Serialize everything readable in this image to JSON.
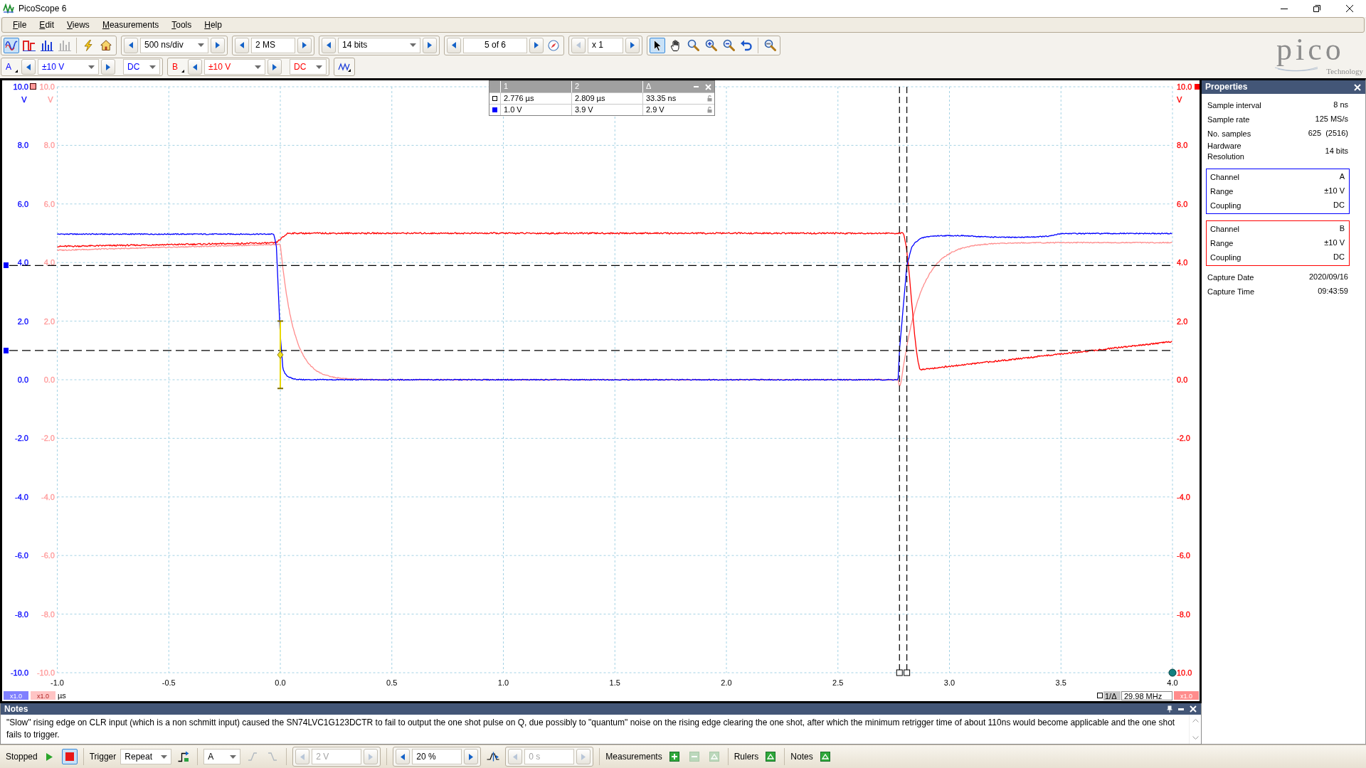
{
  "window": {
    "title": "PicoScope 6",
    "controls": [
      {
        "kind": "minimize"
      },
      {
        "kind": "restore"
      },
      {
        "kind": "close"
      }
    ]
  },
  "menu": [
    {
      "label": "File"
    },
    {
      "label": "Edit"
    },
    {
      "label": "Views"
    },
    {
      "label": "Measurements"
    },
    {
      "label": "Tools"
    },
    {
      "label": "Help"
    }
  ],
  "toolbar": {
    "view_modes": [
      {
        "kind": "scope",
        "selected": true,
        "disabled": false
      },
      {
        "kind": "persistence",
        "selected": false,
        "disabled": false
      },
      {
        "kind": "spectrum",
        "selected": false,
        "disabled": false
      },
      {
        "kind": "spectrum",
        "selected": false,
        "disabled": true
      }
    ],
    "setup_buttons": [
      {
        "kind": "auto_setup"
      },
      {
        "kind": "default_setup"
      }
    ],
    "timebase": "500 ns/div",
    "samples": "2 MS",
    "resolution": "14 bits",
    "buffer": "5 of 6",
    "zoom": {
      "value": "x 1",
      "decrease_disabled": true
    },
    "tools": [
      {
        "kind": "pointer",
        "selected": true
      },
      {
        "kind": "hand",
        "selected": false
      },
      {
        "kind": "zoom_region",
        "selected": false
      },
      {
        "kind": "zoom_in",
        "selected": false
      },
      {
        "kind": "zoom_out",
        "selected": false
      },
      {
        "kind": "undo",
        "selected": false
      },
      {
        "kind": "zoom_fit",
        "selected": false
      }
    ]
  },
  "logo": {
    "wordmark": "pico",
    "tagline": "Technology"
  },
  "channels": [
    {
      "label": "A",
      "color": "#0000ff",
      "range": "±10 V",
      "coupling": "DC"
    },
    {
      "label": "B",
      "color": "#ff0000",
      "range": "±10 V",
      "coupling": "DC"
    }
  ],
  "scope": {
    "left_axes": [
      {
        "color": "#0000ff",
        "unit": "V",
        "labels": [
          "10.0",
          "8.0",
          "6.0",
          "4.0",
          "2.0",
          "0.0",
          "-2.0",
          "-4.0",
          "-6.0",
          "-8.0",
          "-10.0"
        ]
      },
      {
        "color": "#ff9999",
        "unit": "V",
        "labels": [
          "10.0",
          "8.0",
          "6.0",
          "4.0",
          "2.0",
          "0.0",
          "-2.0",
          "-4.0",
          "-6.0",
          "-8.0",
          "-10.0"
        ]
      }
    ],
    "right_axis": {
      "color": "#ff0000",
      "unit": "V",
      "labels": [
        "10.0",
        "8.0",
        "6.0",
        "4.0",
        "2.0",
        "0.0",
        "-2.0",
        "-4.0",
        "-6.0",
        "-8.0",
        "10.0"
      ]
    },
    "x_labels": [
      "-1.0",
      "-0.5",
      "0.0",
      "0.5",
      "1.0",
      "1.5",
      "2.0",
      "2.5",
      "3.0",
      "3.5",
      "4.0"
    ],
    "x_unit": "µs",
    "traces": [
      {
        "kind": "pulse_low",
        "color": "#0000ff"
      },
      {
        "kind": "pulse_high",
        "color": "#ff0000"
      },
      {
        "kind": "decay",
        "color": "#ff8c8c"
      }
    ],
    "left_scale_buttons": [
      {
        "label": "x1.0",
        "color": "#8080ff"
      },
      {
        "label": "x1.0",
        "color": "#ffc4c4"
      }
    ],
    "right_scale_button": {
      "label": "x1.0",
      "color": "#ff8c8c"
    },
    "rulers_table": {
      "headers": [
        "1",
        "2",
        "Δ"
      ],
      "rows": [
        {
          "kind": "time",
          "cells": [
            "2.776 µs",
            "2.809 µs",
            "33.35 ns"
          ]
        },
        {
          "kind": "voltage",
          "color": "#0000ff",
          "cells": [
            "1.0 V",
            "3.9 V",
            "2.9 V"
          ]
        }
      ]
    },
    "frequency": {
      "label": "1/Δ",
      "value": "29.98 MHz"
    }
  },
  "properties": {
    "title": "Properties",
    "rows": [
      {
        "label": "Sample interval",
        "value": "8 ns"
      },
      {
        "label": "Sample rate",
        "value": "125 MS/s"
      },
      {
        "label": "No. samples",
        "value": "625  (2516)"
      },
      {
        "label": "Hardware Resolution",
        "value": "14 bits"
      }
    ],
    "channel_boxes": [
      {
        "color": "#0000ff",
        "rows": [
          {
            "label": "Channel",
            "value": "A"
          },
          {
            "label": "Range",
            "value": "±10 V"
          },
          {
            "label": "Coupling",
            "value": "DC"
          }
        ]
      },
      {
        "color": "#ff0000",
        "rows": [
          {
            "label": "Channel",
            "value": "B"
          },
          {
            "label": "Range",
            "value": "±10 V"
          },
          {
            "label": "Coupling",
            "value": "DC"
          }
        ]
      }
    ],
    "capture_rows": [
      {
        "label": "Capture Date",
        "value": "2020/09/16"
      },
      {
        "label": "Capture Time",
        "value": "09:43:59"
      }
    ]
  },
  "notes": {
    "title": "Notes",
    "text": "\"Slow\" rising edge on CLR input (which is a non schmitt input) caused the SN74LVC1G123DCTR to fail to output the one shot pulse on Q, due possibly to \"quantum\" noise on the rising edge clearing the one shot, after which the minimum retrigger time of about 110ns would become applicable and the one shot fails to trigger."
  },
  "status_bar": {
    "status": "Stopped",
    "run_controls": [
      {
        "kind": "play",
        "selected": false
      },
      {
        "kind": "stop",
        "selected": true
      }
    ],
    "trigger_label": "Trigger",
    "trigger_mode": "Repeat",
    "trigger_source": "A",
    "edge_buttons": [
      {
        "kind": "rising",
        "disabled": true
      },
      {
        "kind": "falling",
        "disabled": true
      }
    ],
    "threshold": {
      "value": "2 V",
      "disabled": true
    },
    "pre_trigger": {
      "value": "20 %",
      "disabled": false
    },
    "delay": {
      "value": "0 s",
      "disabled": true
    },
    "panels": [
      {
        "label": "Measurements",
        "actions": [
          {
            "kind": "add",
            "disabled": false
          },
          {
            "kind": "remove",
            "disabled": true
          },
          {
            "kind": "edit",
            "disabled": true
          }
        ]
      },
      {
        "label": "Rulers",
        "actions": [
          {
            "kind": "show",
            "disabled": false
          }
        ]
      },
      {
        "label": "Notes",
        "actions": [
          {
            "kind": "show",
            "disabled": false
          }
        ]
      }
    ]
  }
}
